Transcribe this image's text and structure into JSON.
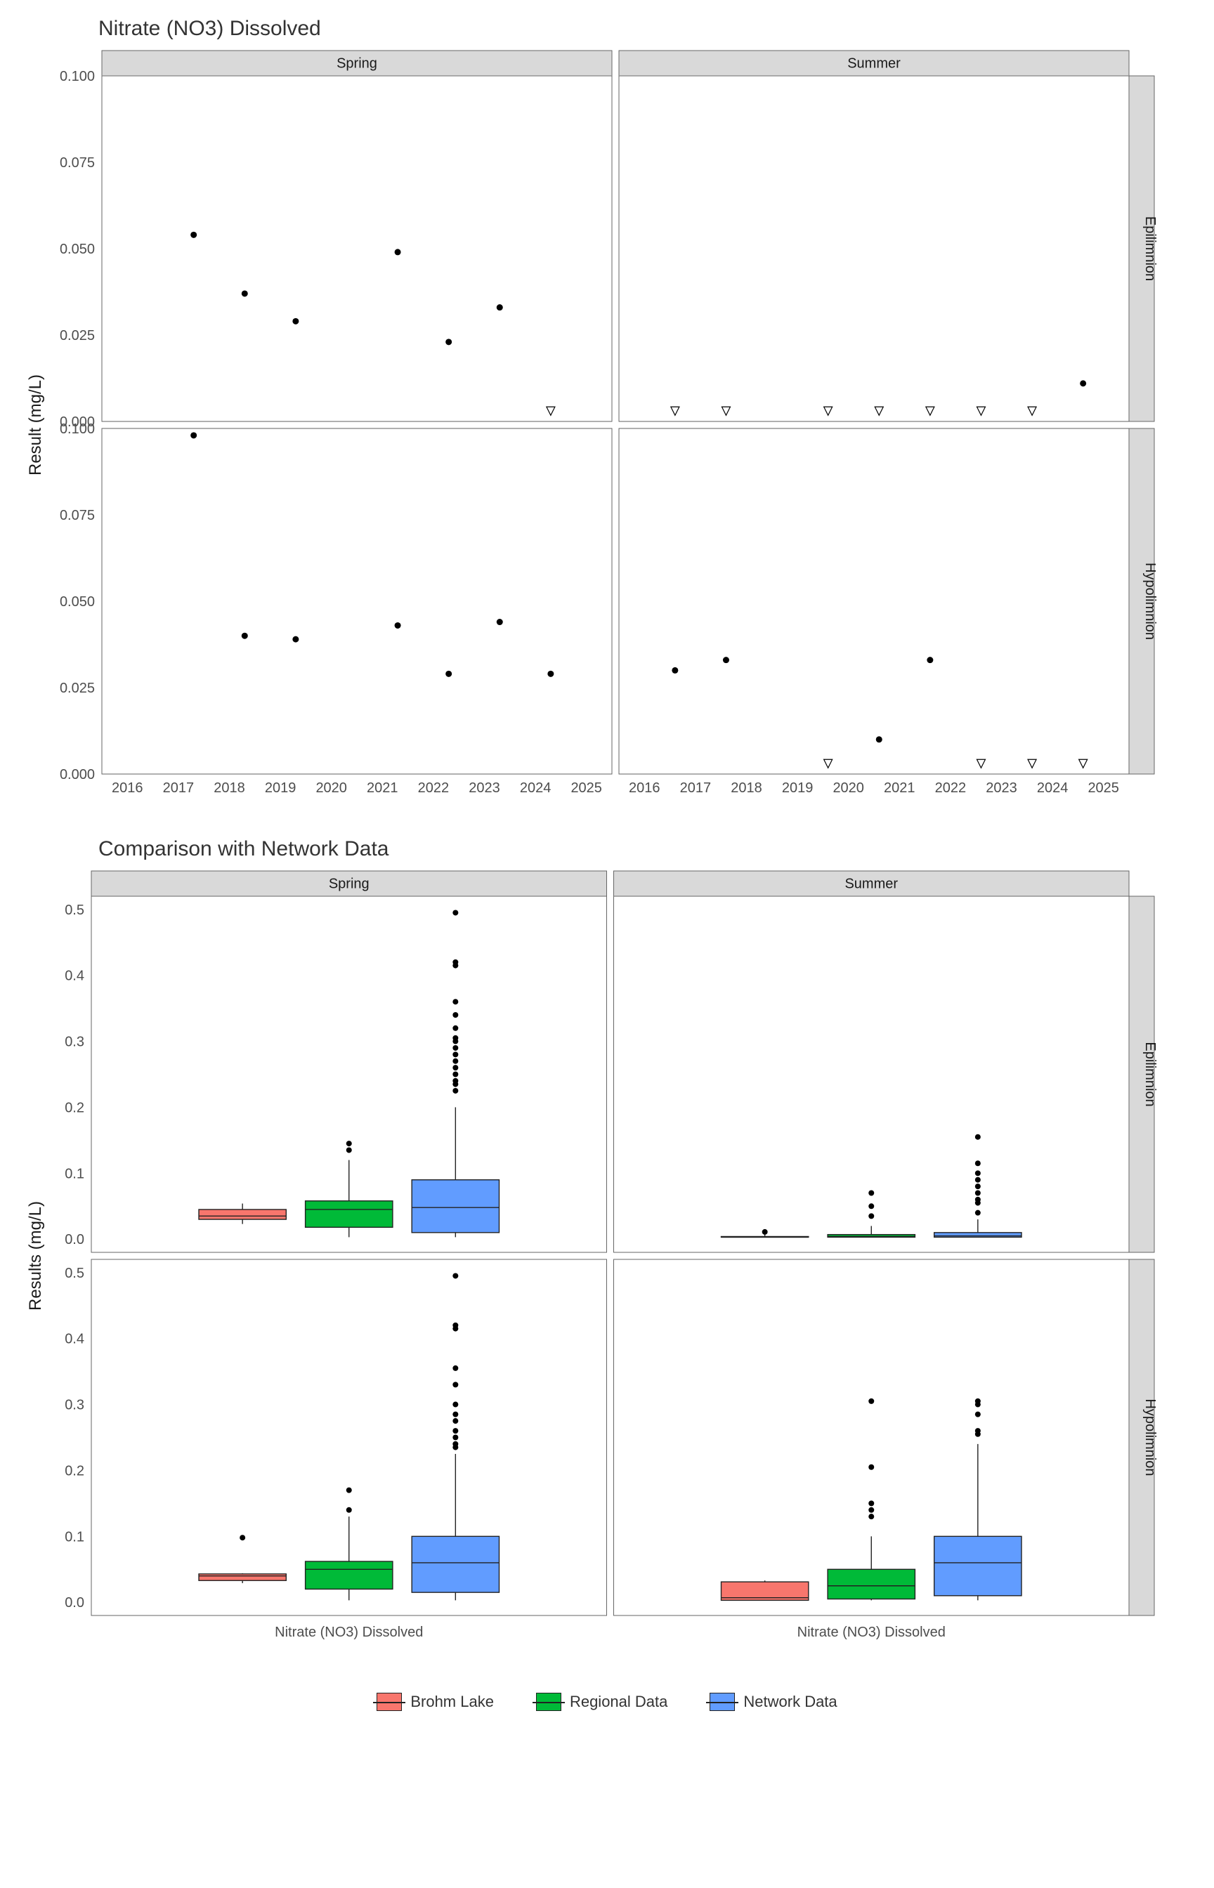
{
  "chart_data": [
    {
      "type": "scatter",
      "title": "Nitrate (NO3) Dissolved",
      "ylabel": "Result (mg/L)",
      "ylim": [
        0,
        0.1
      ],
      "xlim": [
        2015.5,
        2025.5
      ],
      "x_ticks": [
        2016,
        2017,
        2018,
        2019,
        2020,
        2021,
        2022,
        2023,
        2024,
        2025
      ],
      "y_ticks": [
        0.0,
        0.025,
        0.05,
        0.075,
        0.1
      ],
      "col_facets": [
        "Spring",
        "Summer"
      ],
      "row_facets": [
        "Epilimnion",
        "Hypolimnion"
      ],
      "panels": {
        "Spring|Epilimnion": {
          "dots": [
            {
              "x": 2017.3,
              "y": 0.054
            },
            {
              "x": 2018.3,
              "y": 0.037
            },
            {
              "x": 2019.3,
              "y": 0.029
            },
            {
              "x": 2021.3,
              "y": 0.049
            },
            {
              "x": 2022.3,
              "y": 0.023
            },
            {
              "x": 2023.3,
              "y": 0.033
            }
          ],
          "triangles": [
            {
              "x": 2024.3,
              "y": 0.003
            }
          ]
        },
        "Summer|Epilimnion": {
          "dots": [
            {
              "x": 2024.6,
              "y": 0.011
            }
          ],
          "triangles": [
            {
              "x": 2016.6,
              "y": 0.003
            },
            {
              "x": 2017.6,
              "y": 0.003
            },
            {
              "x": 2019.6,
              "y": 0.003
            },
            {
              "x": 2020.6,
              "y": 0.003
            },
            {
              "x": 2021.6,
              "y": 0.003
            },
            {
              "x": 2022.6,
              "y": 0.003
            },
            {
              "x": 2023.6,
              "y": 0.003
            }
          ]
        },
        "Spring|Hypolimnion": {
          "dots": [
            {
              "x": 2017.3,
              "y": 0.098
            },
            {
              "x": 2018.3,
              "y": 0.04
            },
            {
              "x": 2019.3,
              "y": 0.039
            },
            {
              "x": 2021.3,
              "y": 0.043
            },
            {
              "x": 2022.3,
              "y": 0.029
            },
            {
              "x": 2023.3,
              "y": 0.044
            },
            {
              "x": 2024.3,
              "y": 0.029
            }
          ],
          "triangles": []
        },
        "Summer|Hypolimnion": {
          "dots": [
            {
              "x": 2016.6,
              "y": 0.03
            },
            {
              "x": 2017.6,
              "y": 0.033
            },
            {
              "x": 2020.6,
              "y": 0.01
            },
            {
              "x": 2021.6,
              "y": 0.033
            }
          ],
          "triangles": [
            {
              "x": 2019.6,
              "y": 0.003
            },
            {
              "x": 2022.6,
              "y": 0.003
            },
            {
              "x": 2023.6,
              "y": 0.003
            },
            {
              "x": 2024.6,
              "y": 0.003
            }
          ]
        }
      }
    },
    {
      "type": "boxplot",
      "title": "Comparison with Network Data",
      "ylabel": "Results (mg/L)",
      "ylim": [
        -0.02,
        0.52
      ],
      "y_ticks": [
        0.0,
        0.1,
        0.2,
        0.3,
        0.4,
        0.5
      ],
      "x_category_label": "Nitrate (NO3) Dissolved",
      "col_facets": [
        "Spring",
        "Summer"
      ],
      "row_facets": [
        "Epilimnion",
        "Hypolimnion"
      ],
      "series": [
        {
          "name": "Brohm Lake",
          "color": "#F8766D"
        },
        {
          "name": "Regional Data",
          "color": "#00BA38"
        },
        {
          "name": "Network Data",
          "color": "#619CFF"
        }
      ],
      "panels": {
        "Spring|Epilimnion": {
          "boxes": [
            {
              "series": "Brohm Lake",
              "min": 0.023,
              "q1": 0.03,
              "med": 0.035,
              "q3": 0.045,
              "max": 0.054,
              "outliers": []
            },
            {
              "series": "Regional Data",
              "min": 0.003,
              "q1": 0.018,
              "med": 0.045,
              "q3": 0.058,
              "max": 0.12,
              "outliers": [
                0.135,
                0.145
              ]
            },
            {
              "series": "Network Data",
              "min": 0.003,
              "q1": 0.01,
              "med": 0.048,
              "q3": 0.09,
              "max": 0.2,
              "outliers": [
                0.225,
                0.235,
                0.24,
                0.25,
                0.26,
                0.27,
                0.28,
                0.29,
                0.3,
                0.305,
                0.32,
                0.34,
                0.36,
                0.415,
                0.42,
                0.495
              ]
            }
          ]
        },
        "Summer|Epilimnion": {
          "boxes": [
            {
              "series": "Brohm Lake",
              "min": 0.003,
              "q1": 0.003,
              "med": 0.003,
              "q3": 0.004,
              "max": 0.011,
              "outliers": [
                0.011
              ]
            },
            {
              "series": "Regional Data",
              "min": 0.003,
              "q1": 0.003,
              "med": 0.004,
              "q3": 0.007,
              "max": 0.02,
              "outliers": [
                0.035,
                0.05,
                0.07
              ]
            },
            {
              "series": "Network Data",
              "min": 0.003,
              "q1": 0.003,
              "med": 0.005,
              "q3": 0.01,
              "max": 0.03,
              "outliers": [
                0.04,
                0.055,
                0.06,
                0.07,
                0.08,
                0.09,
                0.1,
                0.115,
                0.155
              ]
            }
          ]
        },
        "Spring|Hypolimnion": {
          "boxes": [
            {
              "series": "Brohm Lake",
              "min": 0.029,
              "q1": 0.033,
              "med": 0.04,
              "q3": 0.043,
              "max": 0.044,
              "outliers": [
                0.098
              ]
            },
            {
              "series": "Regional Data",
              "min": 0.003,
              "q1": 0.02,
              "med": 0.05,
              "q3": 0.062,
              "max": 0.13,
              "outliers": [
                0.14,
                0.17
              ]
            },
            {
              "series": "Network Data",
              "min": 0.003,
              "q1": 0.015,
              "med": 0.06,
              "q3": 0.1,
              "max": 0.225,
              "outliers": [
                0.235,
                0.24,
                0.25,
                0.26,
                0.275,
                0.285,
                0.3,
                0.33,
                0.355,
                0.415,
                0.42,
                0.495
              ]
            }
          ]
        },
        "Summer|Hypolimnion": {
          "boxes": [
            {
              "series": "Brohm Lake",
              "min": 0.003,
              "q1": 0.003,
              "med": 0.007,
              "q3": 0.031,
              "max": 0.033,
              "outliers": []
            },
            {
              "series": "Regional Data",
              "min": 0.003,
              "q1": 0.005,
              "med": 0.025,
              "q3": 0.05,
              "max": 0.1,
              "outliers": [
                0.13,
                0.14,
                0.15,
                0.205,
                0.305
              ]
            },
            {
              "series": "Network Data",
              "min": 0.003,
              "q1": 0.01,
              "med": 0.06,
              "q3": 0.1,
              "max": 0.24,
              "outliers": [
                0.255,
                0.26,
                0.285,
                0.3,
                0.305
              ]
            }
          ]
        }
      }
    }
  ],
  "titles": {
    "scatter": "Nitrate (NO3) Dissolved",
    "box": "Comparison with Network Data"
  },
  "axis_labels": {
    "scatter_y": "Result (mg/L)",
    "box_y": "Results (mg/L)",
    "box_x_cat": "Nitrate (NO3) Dissolved"
  },
  "legend": {
    "items": [
      {
        "label": "Brohm Lake",
        "color": "#F8766D"
      },
      {
        "label": "Regional Data",
        "color": "#00BA38"
      },
      {
        "label": "Network Data",
        "color": "#619CFF"
      }
    ]
  }
}
